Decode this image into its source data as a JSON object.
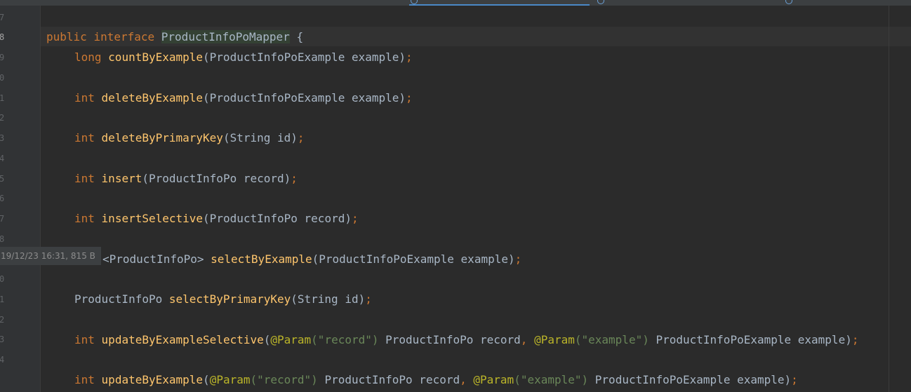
{
  "gutter": {
    "line_numbers": [
      "7",
      "8",
      "9",
      "0",
      "1",
      "2",
      "3",
      "4",
      "5",
      "6",
      "7",
      "8",
      "0",
      "1",
      "2",
      "3",
      "4"
    ],
    "current_line": "8"
  },
  "blame_tooltip": "19/12/23 16:31, 815 B",
  "code": {
    "line8": {
      "kw1": "public",
      "kw2": "interface",
      "name": "ProductInfoPoMapper",
      "brace": "{"
    },
    "line9": {
      "type": "long",
      "fn": "countByExample",
      "params": "(ProductInfoPoExample example)",
      "semi": ";"
    },
    "line11": {
      "type": "int",
      "fn": "deleteByExample",
      "params": "(ProductInfoPoExample example)",
      "semi": ";"
    },
    "line13": {
      "type": "int",
      "fn": "deleteByPrimaryKey",
      "params": "(String id)",
      "semi": ";"
    },
    "line15": {
      "type": "int",
      "fn": "insert",
      "params": "(ProductInfoPo record)",
      "semi": ";"
    },
    "line17": {
      "type": "int",
      "fn": "insertSelective",
      "params": "(ProductInfoPo record)",
      "semi": ";"
    },
    "line19": {
      "type": "<ProductInfoPo> ",
      "fn": "selectByExample",
      "params": "(ProductInfoPoExample example)",
      "semi": ";"
    },
    "line21": {
      "type": "ProductInfoPo ",
      "fn": "selectByPrimaryKey",
      "params": "(String id)",
      "semi": ";"
    },
    "line23": {
      "type": "int",
      "fn": "updateByExampleSelective",
      "open": "(",
      "ann1": "@Param",
      "s1": "(\"record\")",
      "p1": " ProductInfoPo record",
      "comma": ",",
      "ann2": "@Param",
      "s2": "(\"example\")",
      "p2": " ProductInfoPoExample example",
      "close": ")",
      "semi": ";"
    },
    "line25": {
      "type": "int",
      "fn": "updateByExample",
      "open": "(",
      "ann1": "@Param",
      "s1": "(\"record\")",
      "p1": " ProductInfoPo record",
      "comma": ",",
      "ann2": "@Param",
      "s2": "(\"example\")",
      "p2": " ProductInfoPoExample example",
      "close": ")",
      "semi": ";"
    }
  }
}
